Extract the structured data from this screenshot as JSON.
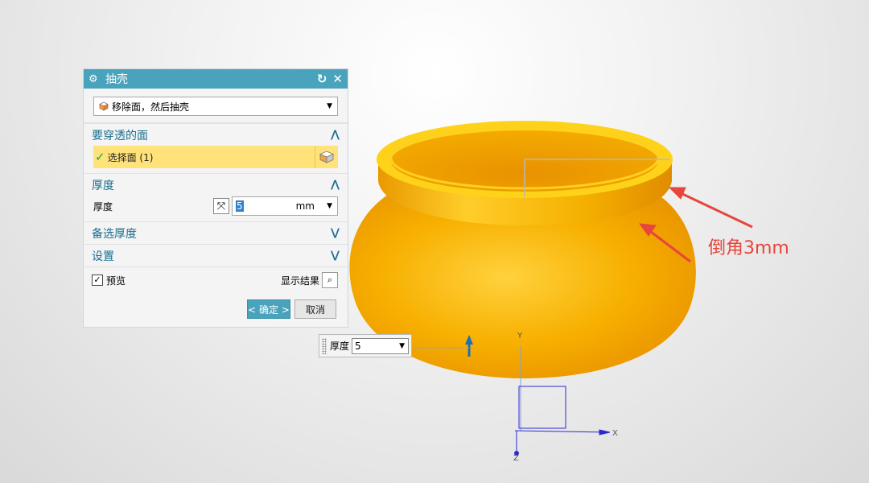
{
  "dialog": {
    "title": "抽壳",
    "method_select": "移除面，然后抽壳",
    "section_faces": {
      "label": "要穿透的面",
      "select_face": "选择面 (1)"
    },
    "section_thickness": {
      "label": "厚度",
      "row_label": "厚度",
      "value": "5",
      "unit": "mm"
    },
    "section_alt_thickness": {
      "label": "备选厚度"
    },
    "section_settings": {
      "label": "设置"
    },
    "preview": {
      "label": "预览",
      "checked": true,
      "show_result": "显示结果"
    },
    "ok_label": "< 确定 >",
    "cancel_label": "取消"
  },
  "floating_input": {
    "label": "厚度",
    "value": "5"
  },
  "annotation": "倒角3mm",
  "axes": {
    "x": "X",
    "y": "Y",
    "z": "Z"
  },
  "colors": {
    "accent": "#4aa3bd",
    "selection": "#ffe27a",
    "model": "#f5a800",
    "annotation": "#e8453c"
  }
}
